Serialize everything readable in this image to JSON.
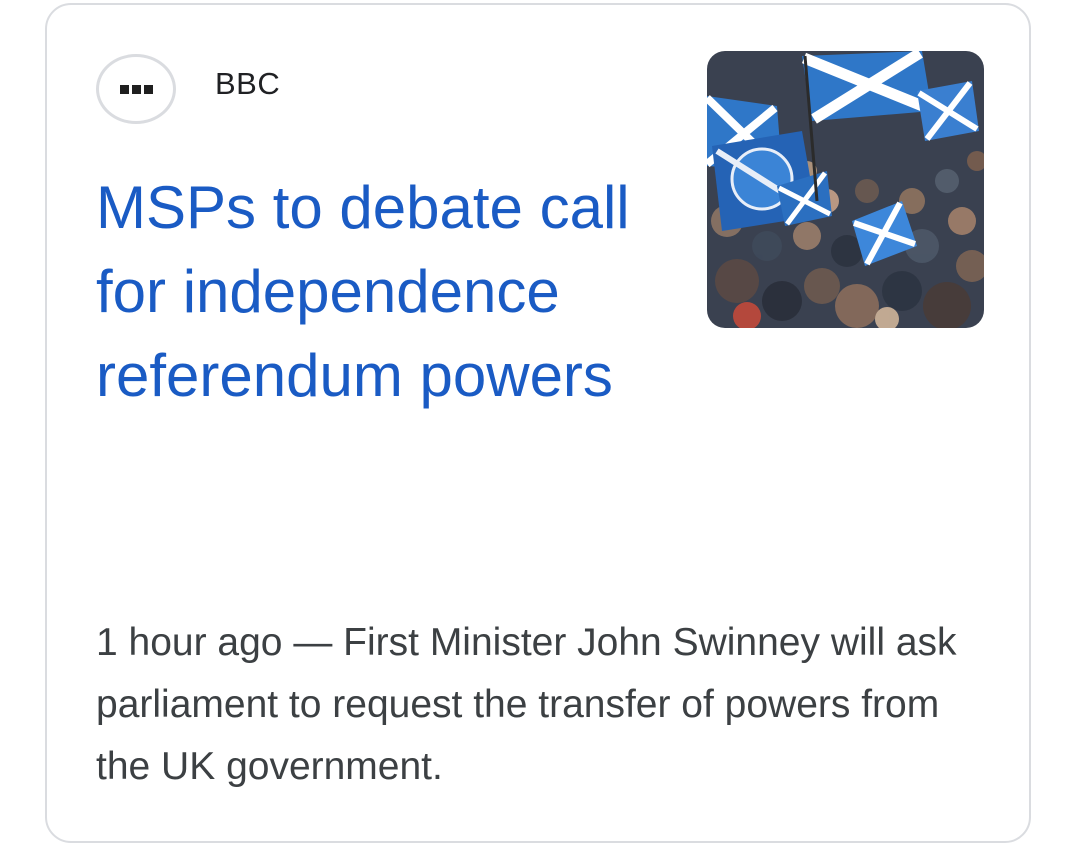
{
  "article": {
    "source": "BBC",
    "source_logo_icon": "bbc-logo-icon",
    "headline": "MSPs to debate call for independence referendum powers",
    "time": "1 hour ago",
    "separator": " — ",
    "snippet": "First Minister John Swinney will ask parliament to request the transfer of powers from the UK government.",
    "thumbnail_icon": "crowd-with-saltire-flags-image"
  },
  "colors": {
    "headline": "#1a5bc4",
    "snippet": "#3c4043",
    "card_border": "#dadce0",
    "flag_blue": "#2f77c8"
  }
}
